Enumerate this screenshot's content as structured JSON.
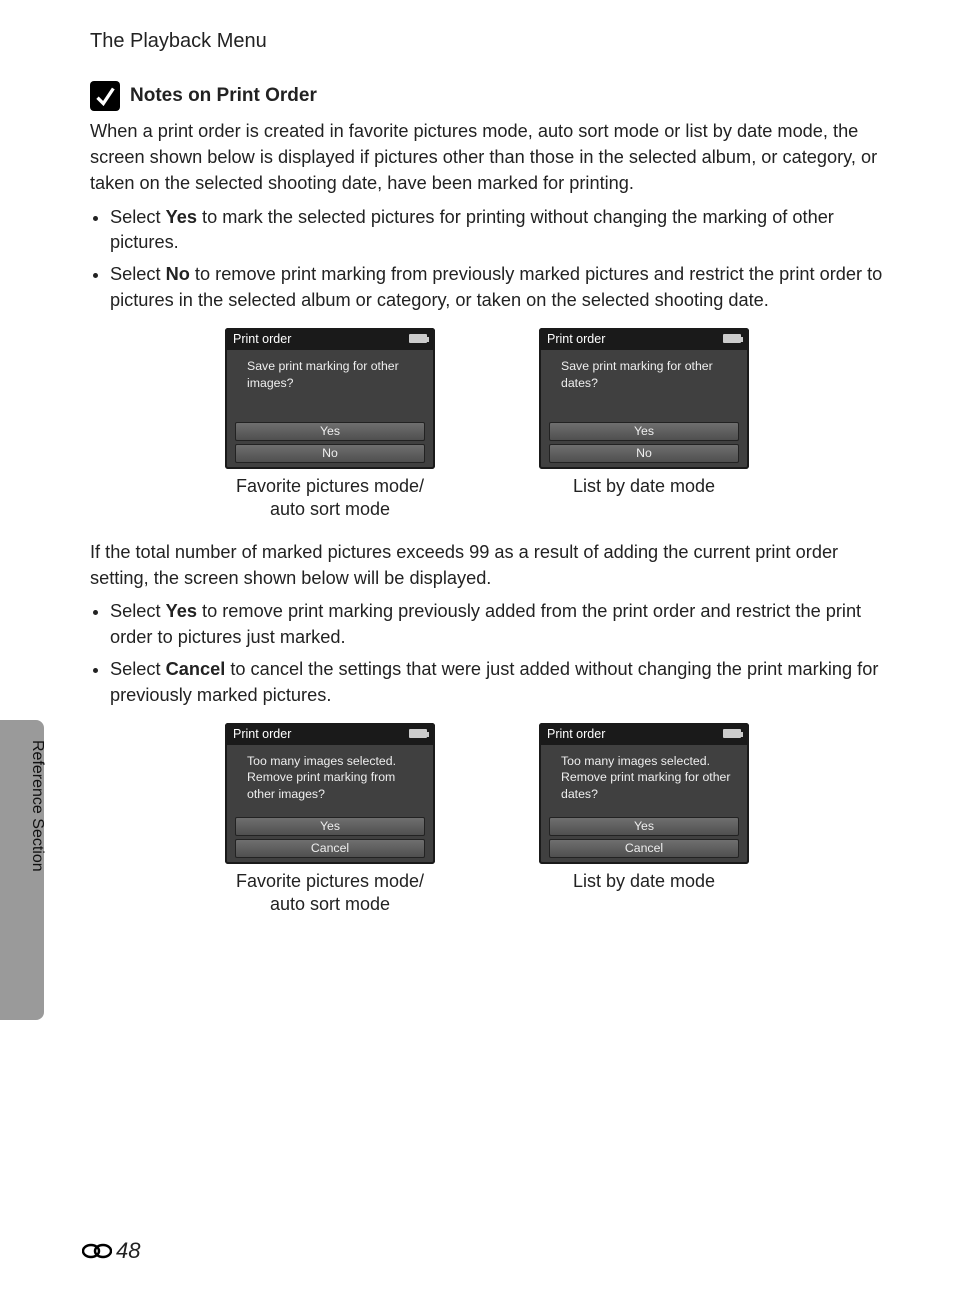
{
  "header": {
    "section": "The Playback Menu"
  },
  "note": {
    "title": "Notes on Print Order"
  },
  "para1": "When a print order is created in favorite pictures mode, auto sort mode or list by date mode, the screen shown below is displayed if pictures other than those in the selected album, or category, or taken on the selected shooting date, have been marked for printing.",
  "list1": [
    {
      "lead": "Select ",
      "bold": "Yes",
      "tail": " to mark the selected pictures for printing without changing the marking of other pictures."
    },
    {
      "lead": "Select ",
      "bold": "No",
      "tail": " to remove print marking from previously marked pictures and restrict the print order to pictures in the selected album or category, or taken on the selected shooting date."
    }
  ],
  "dialogs1": [
    {
      "title": "Print order",
      "msg": "Save print marking for other images?",
      "buttons": [
        "Yes",
        "No"
      ],
      "caption_line1": "Favorite pictures mode/",
      "caption_line2": "auto sort mode"
    },
    {
      "title": "Print order",
      "msg": "Save print marking for other dates?",
      "buttons": [
        "Yes",
        "No"
      ],
      "caption_line1": "List by date mode",
      "caption_line2": ""
    }
  ],
  "para2": "If the total number of marked pictures exceeds 99 as a result of adding the current print order setting, the screen shown below will be displayed.",
  "list2": [
    {
      "lead": "Select ",
      "bold": "Yes",
      "tail": " to remove print marking previously added from the print order and restrict the print order to pictures just marked."
    },
    {
      "lead": "Select ",
      "bold": "Cancel",
      "tail": " to cancel the settings that were just added without changing the print marking for previously marked pictures."
    }
  ],
  "dialogs2": [
    {
      "title": "Print order",
      "msg": "Too many images selected. Remove print marking from other images?",
      "buttons": [
        "Yes",
        "Cancel"
      ],
      "caption_line1": "Favorite pictures mode/",
      "caption_line2": "auto sort mode"
    },
    {
      "title": "Print order",
      "msg": "Too many images selected. Remove print marking for other dates?",
      "buttons": [
        "Yes",
        "Cancel"
      ],
      "caption_line1": "List by date mode",
      "caption_line2": ""
    }
  ],
  "side_label": "Reference Section",
  "page_number": "48"
}
